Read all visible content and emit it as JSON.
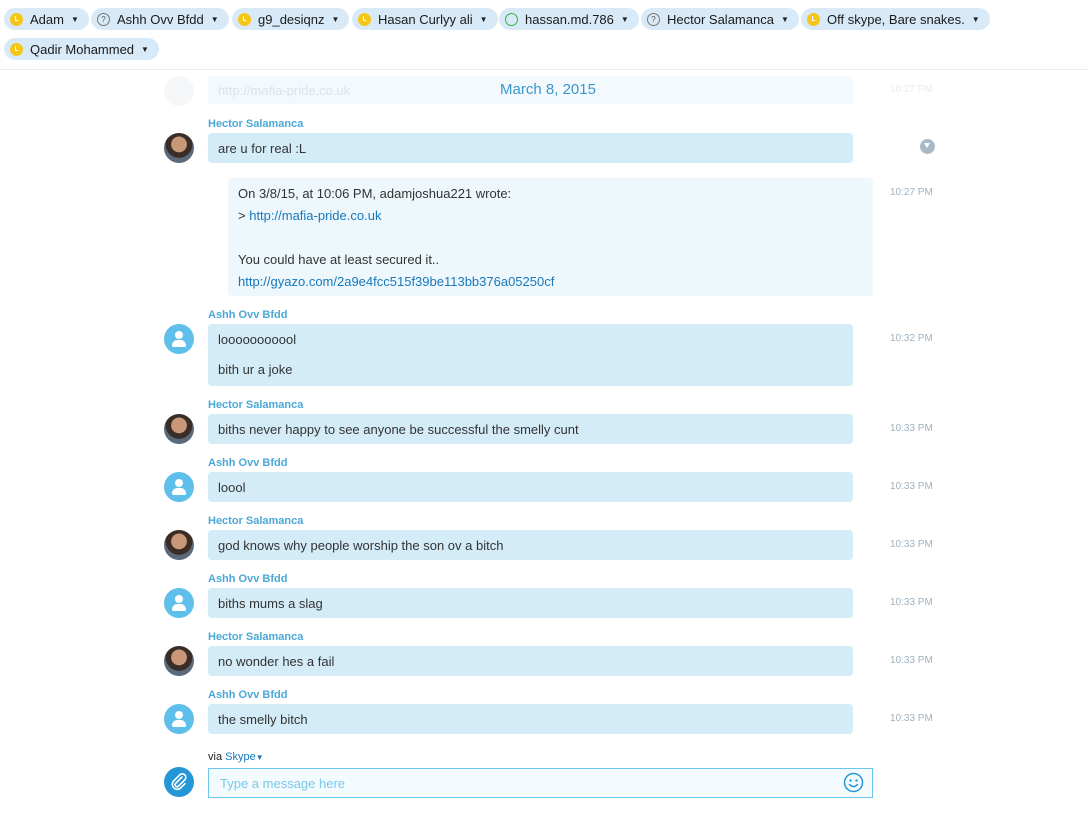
{
  "participants": [
    {
      "name": "Adam",
      "status": "away"
    },
    {
      "name": "Ashh Ovv Bfdd",
      "status": "unknown"
    },
    {
      "name": "g9_desiqnz",
      "status": "away"
    },
    {
      "name": "Hasan Curlyy ali",
      "status": "away"
    },
    {
      "name": "hassan.md.786",
      "status": "online"
    },
    {
      "name": "Hector Salamanca",
      "status": "unknown"
    },
    {
      "name": "Off skype, Bare snakes.",
      "status": "away"
    },
    {
      "name": "Qadir Mohammed",
      "status": "away"
    }
  ],
  "icons": {
    "away": "clock-status-icon",
    "unknown": "question-status-icon",
    "online": "online-status-icon",
    "dropdown": "caret-down-icon",
    "attach": "paperclip-icon",
    "emoji": "smiley-icon",
    "avatar": "default-avatar-icon",
    "scroll": "scroll-to-bottom-icon"
  },
  "colors": {
    "accent": "#4aa8d6",
    "bubble": "#d3ecf8",
    "away": "#f5c518",
    "online": "#36b34a",
    "link": "#1779bb"
  },
  "date_header": "March 8, 2015",
  "faded_message": {
    "text": "http://mafia-pride.co.uk",
    "time": "10:27 PM"
  },
  "messages": [
    {
      "sender": "Hector Salamanca",
      "lines": [
        "are u for real :L"
      ],
      "time": ""
    },
    {
      "quote": {
        "lines": [
          "On 3/8/15, at 10:06 PM, adamjoshua221 wrote:",
          "> http://mafia-pride.co.uk",
          "You could have at least secured it..",
          "http://gyazo.com/2a9e4fcc515f39be113bb376a05250cf"
        ],
        "time": "10:27 PM"
      }
    },
    {
      "sender": "Ashh Ovv Bfdd",
      "lines": [
        "looooooooool",
        "bith ur a joke"
      ],
      "time": "10:32 PM"
    },
    {
      "sender": "Hector Salamanca",
      "lines": [
        "biths never happy to see anyone be successful the smelly cunt"
      ],
      "time": "10:33 PM"
    },
    {
      "sender": "Ashh Ovv Bfdd",
      "lines": [
        "loool"
      ],
      "time": "10:33 PM"
    },
    {
      "sender": "Hector Salamanca",
      "lines": [
        "god knows why people worship the son ov a bitch"
      ],
      "time": "10:33 PM"
    },
    {
      "sender": "Ashh Ovv Bfdd",
      "lines": [
        "biths mums a slag"
      ],
      "time": "10:33 PM"
    },
    {
      "sender": "Hector Salamanca",
      "lines": [
        "no wonder hes a fail"
      ],
      "time": "10:33 PM"
    },
    {
      "sender": "Ashh Ovv Bfdd",
      "lines": [
        "the smelly bitch"
      ],
      "time": "10:33 PM"
    }
  ],
  "composer": {
    "via_label": "via",
    "via_service": "Skype",
    "placeholder": "Type a message here"
  }
}
